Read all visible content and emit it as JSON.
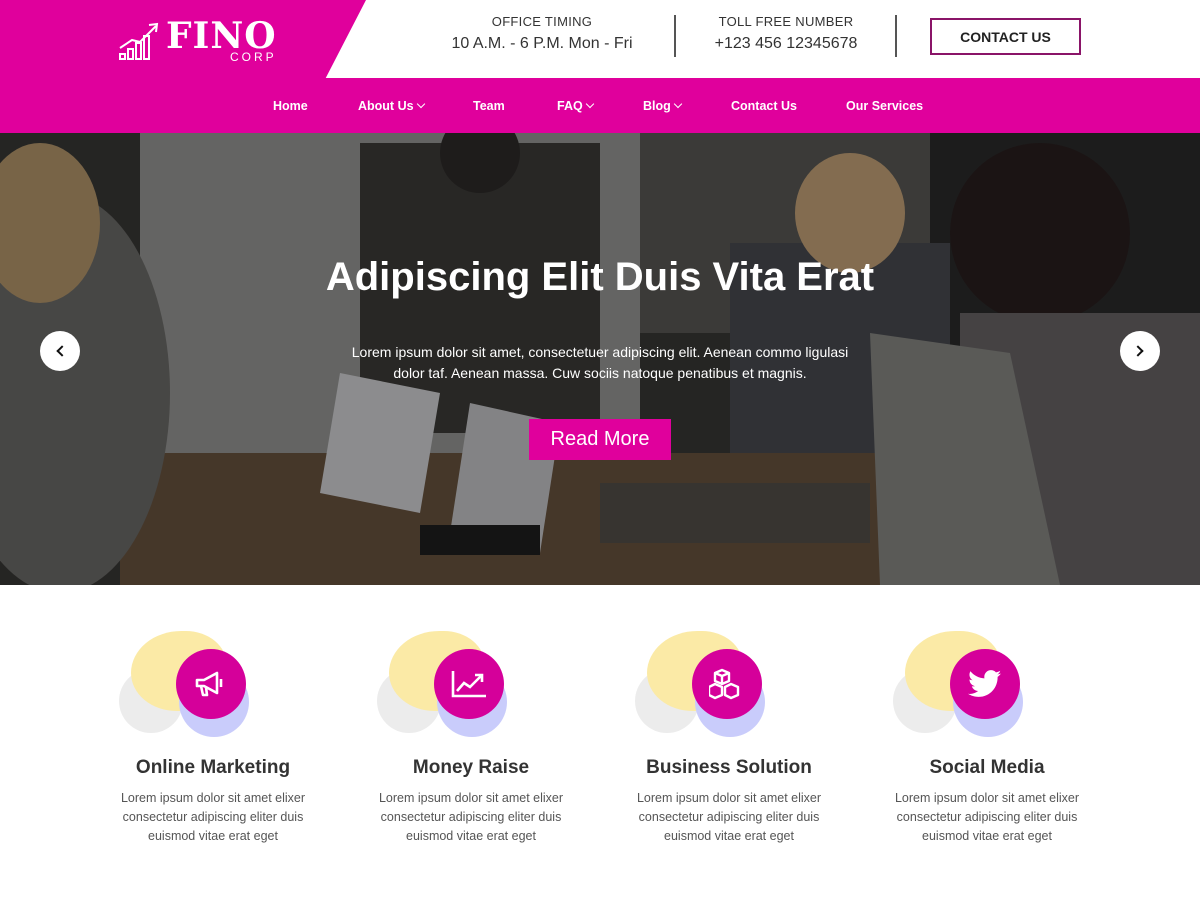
{
  "brand": {
    "name": "FINO",
    "sub": "CORP"
  },
  "header": {
    "office_label": "OFFICE TIMING",
    "office_value": "10 A.M. - 6 P.M. Mon - Fri",
    "phone_label": "TOLL FREE NUMBER",
    "phone_value": "+123 456 12345678",
    "contact_button": "CONTACT US"
  },
  "nav": {
    "items": [
      {
        "label": "Home",
        "dropdown": false
      },
      {
        "label": "About Us",
        "dropdown": true
      },
      {
        "label": "Team",
        "dropdown": false
      },
      {
        "label": "FAQ",
        "dropdown": true
      },
      {
        "label": "Blog",
        "dropdown": true
      },
      {
        "label": "Contact Us",
        "dropdown": false
      },
      {
        "label": "Our Services",
        "dropdown": false
      }
    ]
  },
  "hero": {
    "title": "Adipiscing Elit Duis Vita Erat",
    "text_line1": "Lorem ipsum dolor sit amet, consectetuer adipiscing elit. Aenean commo ligulasi",
    "text_line2": "dolor taf. Aenean massa. Cuw sociis natoque penatibus et magnis.",
    "button": "Read More"
  },
  "services": [
    {
      "icon": "megaphone-icon",
      "title": "Online Marketing",
      "line1": "Lorem ipsum dolor sit amet elixer",
      "line2": "consectetur adipiscing eliter duis",
      "line3": "euismod vitae erat eget"
    },
    {
      "icon": "chart-line-icon",
      "title": "Money Raise",
      "line1": "Lorem ipsum dolor sit amet elixer",
      "line2": "consectetur adipiscing eliter duis",
      "line3": "euismod vitae erat eget"
    },
    {
      "icon": "cubes-icon",
      "title": "Business Solution",
      "line1": "Lorem ipsum dolor sit amet elixer",
      "line2": "consectetur adipiscing eliter duis",
      "line3": "euismod vitae erat eget"
    },
    {
      "icon": "twitter-icon",
      "title": "Social Media",
      "line1": "Lorem ipsum dolor sit amet elixer",
      "line2": "consectetur adipiscing eliter duis",
      "line3": "euismod vitae erat eget"
    }
  ],
  "colors": {
    "accent": "#e0009c",
    "icon_circle": "#d5009a",
    "button_border": "#8a1468"
  }
}
